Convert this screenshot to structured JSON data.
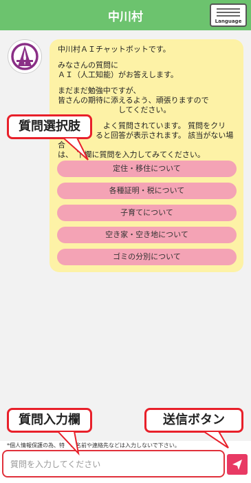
{
  "header": {
    "title": "中川村",
    "language_label": "Language"
  },
  "bot_message": {
    "paragraphs": [
      "中川村ＡＩチャットボットです。",
      "みなさんの質問に\nＡＩ（人工知能）がお答えします。",
      "まだまだ勉強中ですが、\n皆さんの期待に添えるよう、頑張りますので\n　　　　　　　　してください。",
      "　　　　　　よく質問されています。 質問をクリ\n　　　　　ると回答が表示されます。 該当がない場合\nは、　下欄に質問を入力してみてください。"
    ],
    "questions": [
      "定住・移住について",
      "各種証明・税について",
      "子育てについて",
      "空き家・空き地について",
      "ゴミの分別について"
    ]
  },
  "footer": {
    "privacy_note": "*個人情報保護の為、特　の名前や連絡先などは入力しないで下さい。",
    "input_placeholder": "質問を入力してください"
  },
  "annotations": {
    "question_choices": "質問選択肢",
    "question_input": "質問入力欄",
    "send_button": "送信ボタン"
  },
  "colors": {
    "header": "#6cc36e",
    "bubble": "#fdf2a6",
    "question_button": "#f4a3b5",
    "send": "#e83a64",
    "callout_border": "#e8202a"
  }
}
